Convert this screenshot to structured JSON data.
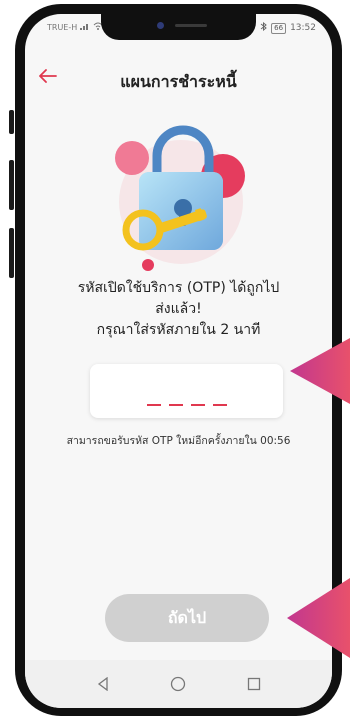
{
  "status_bar": {
    "carrier": "TRUE-H",
    "battery": "66",
    "time": "13:52"
  },
  "header": {
    "back_icon": "arrow-left-icon",
    "title": "แผนการชำระหนี้"
  },
  "illustration": {
    "icon": "padlock-with-key-icon"
  },
  "otp": {
    "message_line1": "รหัสเปิดใช้บริการ (OTP) ได้ถูกไป",
    "message_line2": "ส่งแล้ว!",
    "message_line3": "กรุณาใส่รหัสภายใน 2 นาที",
    "digits": [
      "",
      "",
      "",
      ""
    ],
    "resend_text": "สามารถขอรับรหัส OTP ใหม่อีกครั้งภายใน 00:56"
  },
  "actions": {
    "next_label": "ถัดไป"
  },
  "colors": {
    "accent": "#e0384f",
    "disabled_button": "#d0d0d0",
    "pointer": "#c2378f"
  }
}
